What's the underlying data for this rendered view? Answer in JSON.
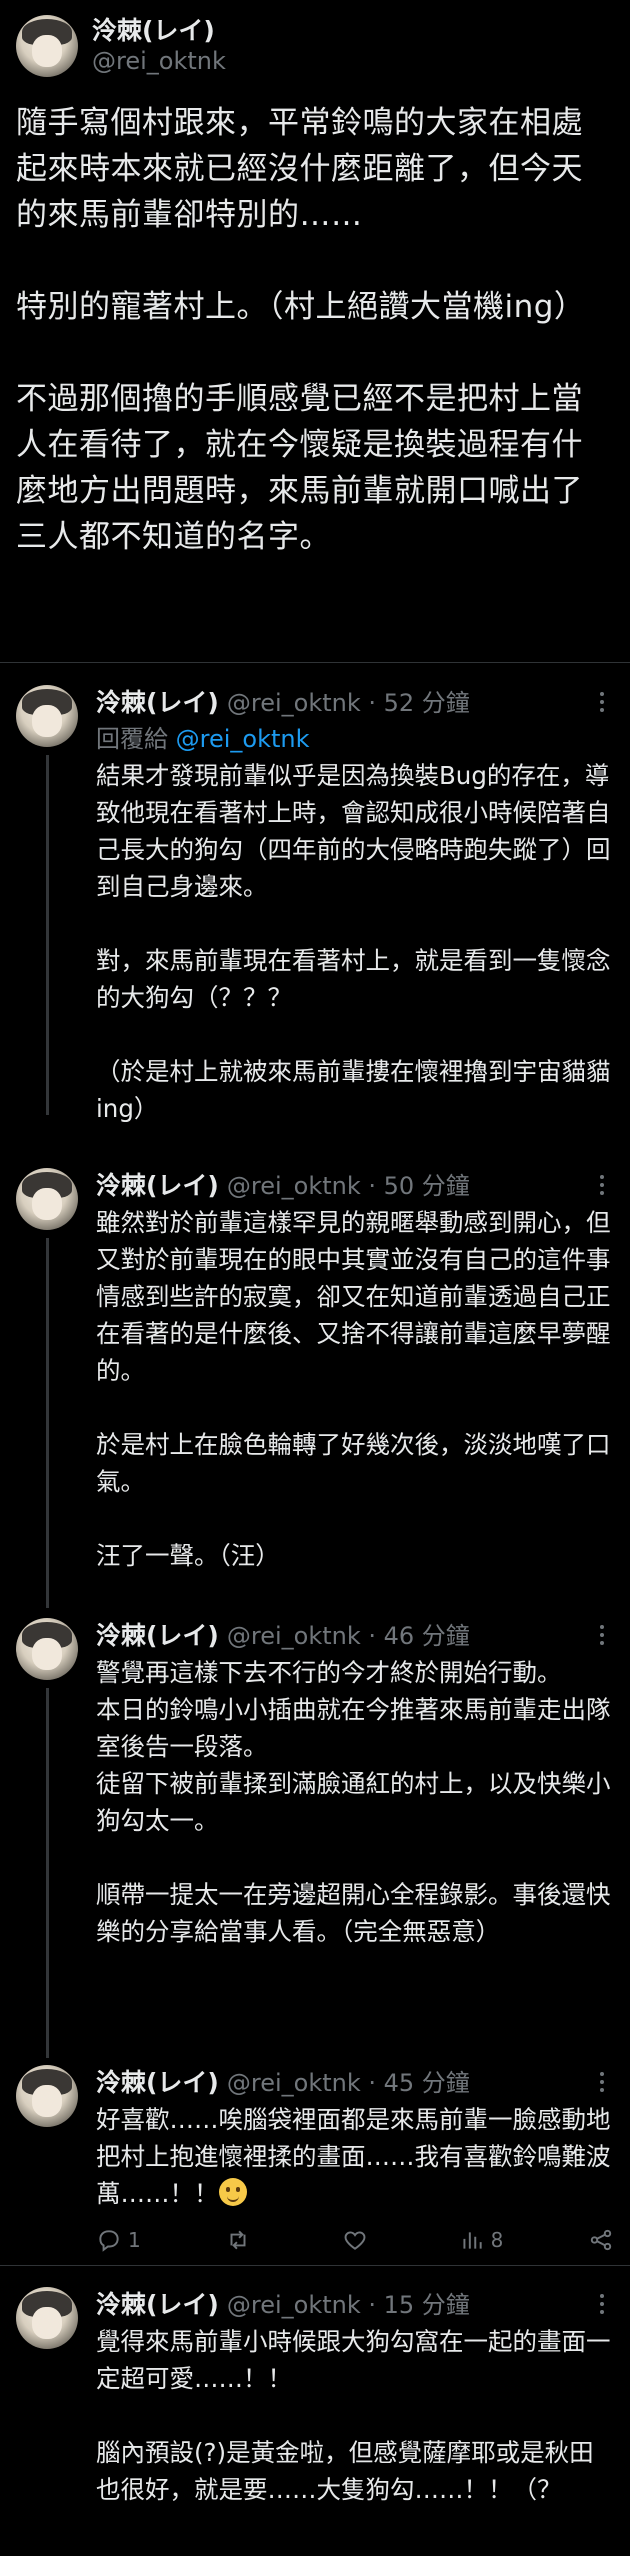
{
  "main_tweet": {
    "display_name": "泠棘(レイ)",
    "handle": "@rei_oktnk",
    "text": "隨手寫個村跟來，平常鈴鳴的大家在相處起來時本來就已經沒什麼距離了，但今天的來馬前輩卻特別的……\n\n特別的寵著村上。（村上絕讚大當機ing）\n\n不過那個擼的手順感覺已經不是把村上當人在看待了，就在今懷疑是換裝過程有什麼地方出問題時，來馬前輩就開口喊出了三人都不知道的名字。"
  },
  "replies": [
    {
      "display_name": "泠棘(レイ)",
      "meta": "@rei_oktnk · 52 分鐘",
      "reply_to_label": "回覆給",
      "reply_to_handle": "@rei_oktnk",
      "text": "結果才發現前輩似乎是因為換裝Bug的存在，導致他現在看著村上時，會認知成很小時候陪著自己長大的狗勾（四年前的大侵略時跑失蹤了）回到自己身邊來。\n\n對，來馬前輩現在看著村上，就是看到一隻懷念的大狗勾（？？？\n\n（於是村上就被來馬前輩摟在懷裡擼到宇宙貓貓ing）"
    },
    {
      "display_name": "泠棘(レイ)",
      "meta": "@rei_oktnk · 50 分鐘",
      "text": "雖然對於前輩這樣罕見的親暱舉動感到開心，但又對於前輩現在的眼中其實並沒有自己的這件事情感到些許的寂寞，卻又在知道前輩透過自己正在看著的是什麼後、又捨不得讓前輩這麼早夢醒的。\n\n於是村上在臉色輪轉了好幾次後，淡淡地嘆了口氣。\n\n汪了一聲。（汪）"
    },
    {
      "display_name": "泠棘(レイ)",
      "meta": "@rei_oktnk · 46 分鐘",
      "text": "警覺再這樣下去不行的今才終於開始行動。\n本日的鈴鳴小小插曲就在今推著來馬前輩走出隊室後告一段落。\n徒留下被前輩揉到滿臉通紅的村上，以及快樂小狗勾太一。\n\n順帶一提太一在旁邊超開心全程錄影。事後還快樂的分享給當事人看。（完全無惡意）"
    },
    {
      "display_name": "泠棘(レイ)",
      "meta": "@rei_oktnk · 45 分鐘",
      "text": "好喜歡……唉腦袋裡面都是來馬前輩一臉感動地把村上抱進懷裡揉的畫面……我有喜歡鈴鳴難波萬……！！",
      "emoji": "smiling-face-with-tear",
      "actions": {
        "reply_count": "1",
        "retweet_count": "",
        "like_count": "",
        "views_count": "8"
      }
    },
    {
      "display_name": "泠棘(レイ)",
      "meta": "@rei_oktnk · 15 分鐘",
      "text": "覺得來馬前輩小時候跟大狗勾窩在一起的畫面一定超可愛……！！\n\n腦內預設(?)是黃金啦，但感覺薩摩耶或是秋田也很好，就是要……大隻狗勾……！！（？"
    }
  ],
  "colors": {
    "background": "#000000",
    "text": "#e7e9ea",
    "muted": "#71767b",
    "accent": "#1d9bf0",
    "divider": "#2f3336"
  }
}
